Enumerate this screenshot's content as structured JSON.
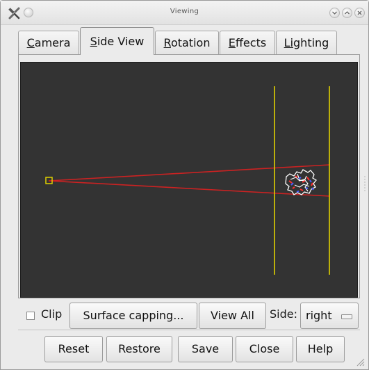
{
  "window": {
    "title": "Viewing"
  },
  "tabs": [
    {
      "label": "Camera",
      "mnemonic": "C",
      "rest": "amera"
    },
    {
      "label": "Side View",
      "mnemonic": "S",
      "rest": "ide View"
    },
    {
      "label": "Rotation",
      "mnemonic": "R",
      "rest": "otation"
    },
    {
      "label": "Effects",
      "mnemonic": "E",
      "rest": "ffects"
    },
    {
      "label": "Lighting",
      "mnemonic": "Li",
      "rest": "ghting",
      "pre": "Li"
    }
  ],
  "active_tab": "Side View",
  "viewport": {
    "background": "#333333",
    "frustum_color": "#cc2222",
    "clip_plane_color": "#e0d000",
    "camera_marker_color": "#e0d000"
  },
  "controls": {
    "clip_label": "Clip",
    "clip_checked": false,
    "surface_capping_label": "Surface capping...",
    "view_all_label": "View All",
    "side_label": "Side:",
    "side_value": "right"
  },
  "buttons": {
    "reset": "Reset",
    "restore": "Restore",
    "save": "Save",
    "close": "Close",
    "help": "Help"
  }
}
